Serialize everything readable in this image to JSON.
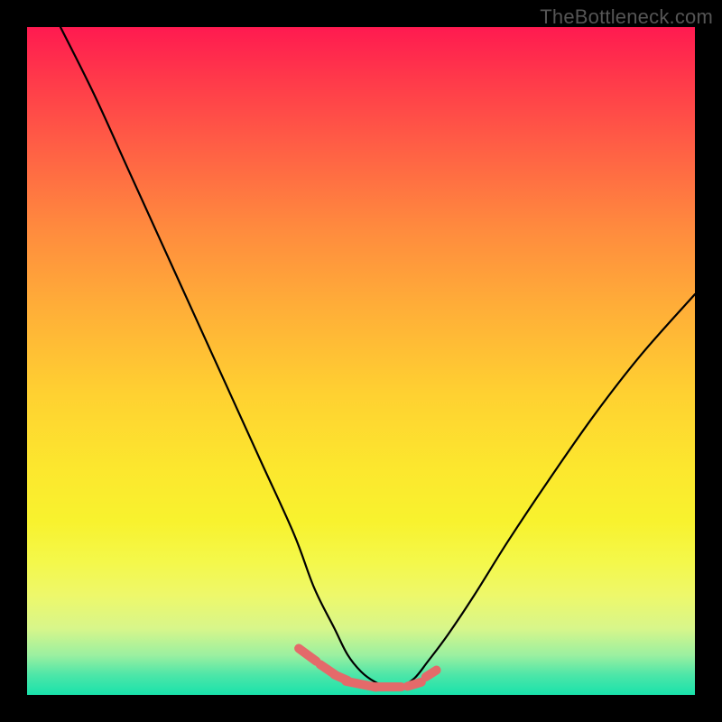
{
  "watermark": "TheBottleneck.com",
  "colors": {
    "frame": "#000000",
    "watermark_text": "#555555",
    "curve_stroke": "#000000",
    "dash_stroke": "#e46a6a",
    "gradient_top": "#ff1a50",
    "gradient_bottom": "#19e2ab"
  },
  "chart_data": {
    "type": "line",
    "title": "",
    "xlabel": "",
    "ylabel": "",
    "x_range": [
      0,
      100
    ],
    "y_range": [
      0,
      100
    ],
    "grid": false,
    "legend": false,
    "notes": "Background vertical gradient encodes y-value (red=high, green=low). Two black curves form a V shape meeting near the bottom; left curve descends steeply from top-left, right curve rises to the right edge. Short salmon dashes sit near the trough of the V.",
    "series": [
      {
        "name": "left_curve",
        "x": [
          5,
          10,
          15,
          20,
          25,
          30,
          35,
          40,
          43,
          46,
          48,
          50,
          52,
          54,
          56
        ],
        "y": [
          100,
          90,
          79,
          68,
          57,
          46,
          35,
          24,
          16,
          10,
          6,
          3.5,
          2,
          1.2,
          1
        ]
      },
      {
        "name": "right_curve",
        "x": [
          54,
          56,
          58,
          60,
          63,
          67,
          72,
          78,
          85,
          92,
          100
        ],
        "y": [
          1,
          1.3,
          2.5,
          5,
          9,
          15,
          23,
          32,
          42,
          51,
          60
        ]
      },
      {
        "name": "trough_dashes",
        "x": [
          42,
          45,
          47,
          50,
          54,
          58,
          60.5
        ],
        "y": [
          6,
          3.8,
          2.6,
          1.6,
          1.2,
          1.6,
          3.2
        ]
      }
    ]
  }
}
